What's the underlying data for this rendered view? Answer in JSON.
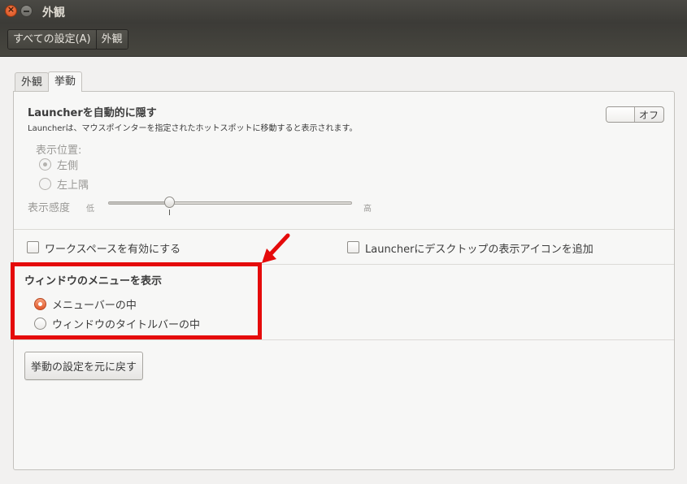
{
  "window": {
    "title": "外観"
  },
  "breadcrumb": {
    "all_settings": "すべての設定(A)",
    "current": "外観"
  },
  "tabs": [
    {
      "label": "外観",
      "active": false
    },
    {
      "label": "挙動",
      "active": true
    }
  ],
  "launcher_autohide": {
    "title": "Launcherを自動的に隠す",
    "description": "Launcherは、マウスポインターを指定されたホットスポットに移動すると表示されます。",
    "toggle_label": "オフ",
    "reveal_location_label": "表示位置:",
    "location_options": [
      {
        "label": "左側",
        "selected": true
      },
      {
        "label": "左上隅",
        "selected": false
      }
    ],
    "sensitivity_label": "表示感度",
    "sensitivity_low": "低",
    "sensitivity_high": "高",
    "sensitivity_value": 0.25
  },
  "checkboxes": {
    "workspaces": {
      "label": "ワークスペースを有効にする",
      "checked": false
    },
    "show_desktop": {
      "label": "Launcherにデスクトップの表示アイコンを追加",
      "checked": false
    }
  },
  "window_menus": {
    "title": "ウィンドウのメニューを表示",
    "options": [
      {
        "label": "メニューバーの中",
        "selected": true
      },
      {
        "label": "ウィンドウのタイトルバーの中",
        "selected": false
      }
    ]
  },
  "reset_button": "挙動の設定を元に戻す",
  "colors": {
    "accent": "#e2582a",
    "annotation": "#e50b0b",
    "titlebar": "#3c3b37"
  }
}
